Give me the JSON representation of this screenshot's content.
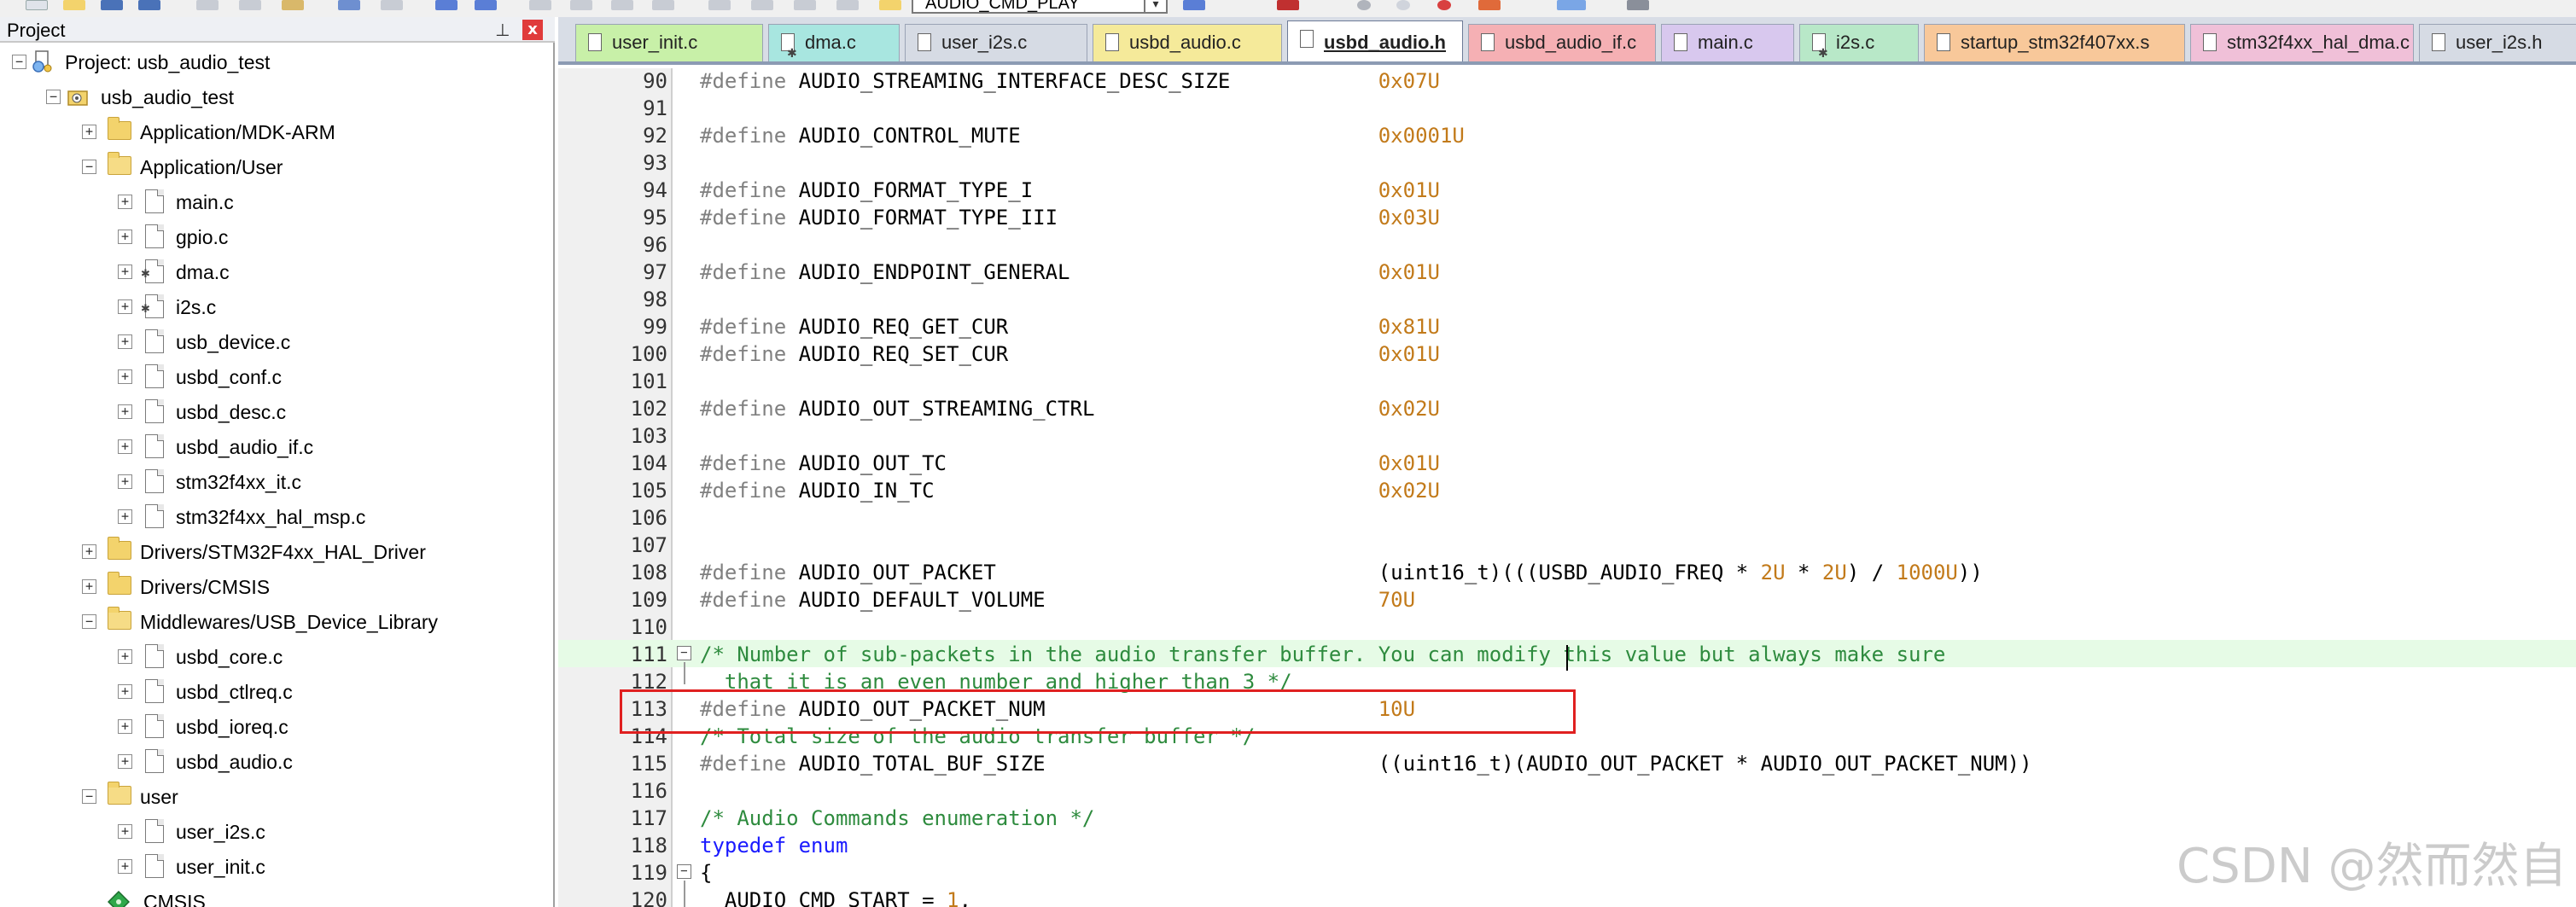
{
  "toolbar": {
    "combo_value": "AUDIO_CMD_PLAY"
  },
  "project_panel": {
    "title": "Project",
    "pin_glyph": "ℵ",
    "close_glyph": "x",
    "tree": [
      {
        "label": "Project: usb_audio_test",
        "kind": "project",
        "level": 0,
        "expander": "-"
      },
      {
        "label": "usb_audio_test",
        "kind": "target",
        "level": 1,
        "expander": "-"
      },
      {
        "label": "Application/MDK-ARM",
        "kind": "folder",
        "level": 2,
        "expander": "+"
      },
      {
        "label": "Application/User",
        "kind": "folder-open",
        "level": 2,
        "expander": "-"
      },
      {
        "label": "main.c",
        "kind": "file",
        "level": 3,
        "expander": "+"
      },
      {
        "label": "gpio.c",
        "kind": "file",
        "level": 3,
        "expander": "+"
      },
      {
        "label": "dma.c",
        "kind": "file-gear",
        "level": 3,
        "expander": "+"
      },
      {
        "label": "i2s.c",
        "kind": "file-gear",
        "level": 3,
        "expander": "+"
      },
      {
        "label": "usb_device.c",
        "kind": "file",
        "level": 3,
        "expander": "+"
      },
      {
        "label": "usbd_conf.c",
        "kind": "file",
        "level": 3,
        "expander": "+"
      },
      {
        "label": "usbd_desc.c",
        "kind": "file",
        "level": 3,
        "expander": "+"
      },
      {
        "label": "usbd_audio_if.c",
        "kind": "file",
        "level": 3,
        "expander": "+"
      },
      {
        "label": "stm32f4xx_it.c",
        "kind": "file",
        "level": 3,
        "expander": "+"
      },
      {
        "label": "stm32f4xx_hal_msp.c",
        "kind": "file",
        "level": 3,
        "expander": "+"
      },
      {
        "label": "Drivers/STM32F4xx_HAL_Driver",
        "kind": "folder",
        "level": 2,
        "expander": "+"
      },
      {
        "label": "Drivers/CMSIS",
        "kind": "folder",
        "level": 2,
        "expander": "+"
      },
      {
        "label": "Middlewares/USB_Device_Library",
        "kind": "folder-open",
        "level": 2,
        "expander": "-"
      },
      {
        "label": "usbd_core.c",
        "kind": "file",
        "level": 3,
        "expander": "+"
      },
      {
        "label": "usbd_ctlreq.c",
        "kind": "file",
        "level": 3,
        "expander": "+"
      },
      {
        "label": "usbd_ioreq.c",
        "kind": "file",
        "level": 3,
        "expander": "+"
      },
      {
        "label": "usbd_audio.c",
        "kind": "file",
        "level": 3,
        "expander": "+"
      },
      {
        "label": "user",
        "kind": "folder-open",
        "level": 2,
        "expander": "-"
      },
      {
        "label": "user_i2s.c",
        "kind": "file",
        "level": 3,
        "expander": "+"
      },
      {
        "label": "user_init.c",
        "kind": "file",
        "level": 3,
        "expander": "+"
      },
      {
        "label": "CMSIS",
        "kind": "cmsis",
        "level": 2,
        "expander": ""
      }
    ]
  },
  "tabs": [
    {
      "label": "user_init.c",
      "color": "#c8f0a8",
      "icon": "file",
      "active": false
    },
    {
      "label": "dma.c",
      "color": "#a8e6e0",
      "icon": "file-gear",
      "active": false
    },
    {
      "label": "user_i2s.c",
      "color": "#d6dbe4",
      "icon": "file",
      "active": false
    },
    {
      "label": "usbd_audio.c",
      "color": "#f5ea9a",
      "icon": "file",
      "active": false
    },
    {
      "label": "usbd_audio.h",
      "color": "#ffffff",
      "icon": "file",
      "active": true
    },
    {
      "label": "usbd_audio_if.c",
      "color": "#f5b0b4",
      "icon": "file",
      "active": false
    },
    {
      "label": "main.c",
      "color": "#d8c8ee",
      "icon": "file",
      "active": false
    },
    {
      "label": "i2s.c",
      "color": "#b8e8c8",
      "icon": "file-gear",
      "active": false
    },
    {
      "label": "startup_stm32f407xx.s",
      "color": "#f8c89a",
      "icon": "file",
      "active": false
    },
    {
      "label": "stm32f4xx_hal_dma.c",
      "color": "#f0c0d8",
      "icon": "file",
      "active": false
    },
    {
      "label": "user_i2s.h",
      "color": "#d6dbe4",
      "icon": "file",
      "active": false
    }
  ],
  "editor": {
    "lines": [
      {
        "no": "90",
        "parts": [
          {
            "t": "#define",
            "c": "pp"
          },
          {
            "t": " AUDIO_STREAMING_INTERFACE_DESC_SIZE            ",
            "c": ""
          },
          {
            "t": "0x07U",
            "c": "num"
          }
        ]
      },
      {
        "no": "91",
        "parts": []
      },
      {
        "no": "92",
        "parts": [
          {
            "t": "#define",
            "c": "pp"
          },
          {
            "t": " AUDIO_CONTROL_MUTE                             ",
            "c": ""
          },
          {
            "t": "0x0001U",
            "c": "num"
          }
        ]
      },
      {
        "no": "93",
        "parts": []
      },
      {
        "no": "94",
        "parts": [
          {
            "t": "#define",
            "c": "pp"
          },
          {
            "t": " AUDIO_FORMAT_TYPE_I                            ",
            "c": ""
          },
          {
            "t": "0x01U",
            "c": "num"
          }
        ]
      },
      {
        "no": "95",
        "parts": [
          {
            "t": "#define",
            "c": "pp"
          },
          {
            "t": " AUDIO_FORMAT_TYPE_III                          ",
            "c": ""
          },
          {
            "t": "0x03U",
            "c": "num"
          }
        ]
      },
      {
        "no": "96",
        "parts": []
      },
      {
        "no": "97",
        "parts": [
          {
            "t": "#define",
            "c": "pp"
          },
          {
            "t": " AUDIO_ENDPOINT_GENERAL                         ",
            "c": ""
          },
          {
            "t": "0x01U",
            "c": "num"
          }
        ]
      },
      {
        "no": "98",
        "parts": []
      },
      {
        "no": "99",
        "parts": [
          {
            "t": "#define",
            "c": "pp"
          },
          {
            "t": " AUDIO_REQ_GET_CUR                              ",
            "c": ""
          },
          {
            "t": "0x81U",
            "c": "num"
          }
        ]
      },
      {
        "no": "100",
        "parts": [
          {
            "t": "#define",
            "c": "pp"
          },
          {
            "t": " AUDIO_REQ_SET_CUR                              ",
            "c": ""
          },
          {
            "t": "0x01U",
            "c": "num"
          }
        ]
      },
      {
        "no": "101",
        "parts": []
      },
      {
        "no": "102",
        "parts": [
          {
            "t": "#define",
            "c": "pp"
          },
          {
            "t": " AUDIO_OUT_STREAMING_CTRL                       ",
            "c": ""
          },
          {
            "t": "0x02U",
            "c": "num"
          }
        ]
      },
      {
        "no": "103",
        "parts": []
      },
      {
        "no": "104",
        "parts": [
          {
            "t": "#define",
            "c": "pp"
          },
          {
            "t": " AUDIO_OUT_TC                                   ",
            "c": ""
          },
          {
            "t": "0x01U",
            "c": "num"
          }
        ]
      },
      {
        "no": "105",
        "parts": [
          {
            "t": "#define",
            "c": "pp"
          },
          {
            "t": " AUDIO_IN_TC                                    ",
            "c": ""
          },
          {
            "t": "0x02U",
            "c": "num"
          }
        ]
      },
      {
        "no": "106",
        "parts": []
      },
      {
        "no": "107",
        "parts": []
      },
      {
        "no": "108",
        "parts": [
          {
            "t": "#define",
            "c": "pp"
          },
          {
            "t": " AUDIO_OUT_PACKET                               (uint16_t)(((USBD_AUDIO_FREQ * ",
            "c": ""
          },
          {
            "t": "2U",
            "c": "num"
          },
          {
            "t": " * ",
            "c": ""
          },
          {
            "t": "2U",
            "c": "num"
          },
          {
            "t": ") / ",
            "c": ""
          },
          {
            "t": "1000U",
            "c": "num"
          },
          {
            "t": "))",
            "c": ""
          }
        ]
      },
      {
        "no": "109",
        "parts": [
          {
            "t": "#define",
            "c": "pp"
          },
          {
            "t": " AUDIO_DEFAULT_VOLUME                           ",
            "c": ""
          },
          {
            "t": "70U",
            "c": "num"
          }
        ]
      },
      {
        "no": "110",
        "parts": []
      },
      {
        "no": "111",
        "parts": [
          {
            "t": "/* Number of sub-packets in the audio transfer buffer. You can modify this value but always make sure",
            "c": "cm"
          }
        ],
        "hl": true,
        "fold": "-"
      },
      {
        "no": "112",
        "parts": [
          {
            "t": "  that it is an even number and higher than 3 */",
            "c": "cm"
          }
        ]
      },
      {
        "no": "113",
        "parts": [
          {
            "t": "#define",
            "c": "pp"
          },
          {
            "t": " AUDIO_OUT_PACKET_NUM                           ",
            "c": ""
          },
          {
            "t": "10U",
            "c": "num"
          }
        ]
      },
      {
        "no": "114",
        "parts": [
          {
            "t": "/* Total size of the audio transfer buffer */",
            "c": "cm"
          }
        ]
      },
      {
        "no": "115",
        "parts": [
          {
            "t": "#define",
            "c": "pp"
          },
          {
            "t": " AUDIO_TOTAL_BUF_SIZE                           ((uint16_t)(AUDIO_OUT_PACKET * AUDIO_OUT_PACKET_NUM))",
            "c": ""
          }
        ]
      },
      {
        "no": "116",
        "parts": []
      },
      {
        "no": "117",
        "parts": [
          {
            "t": "/* Audio Commands enumeration */",
            "c": "cm"
          }
        ]
      },
      {
        "no": "118",
        "parts": [
          {
            "t": "typedef",
            "c": "kw"
          },
          {
            "t": " ",
            "c": ""
          },
          {
            "t": "enum",
            "c": "kw"
          }
        ]
      },
      {
        "no": "119",
        "parts": [
          {
            "t": "{",
            "c": ""
          }
        ],
        "fold": "-"
      },
      {
        "no": "120",
        "parts": [
          {
            "t": "  AUDIO_CMD_START = ",
            "c": ""
          },
          {
            "t": "1",
            "c": "num"
          },
          {
            "t": ",",
            "c": ""
          }
        ]
      }
    ]
  },
  "watermark": "CSDN @然而然自"
}
